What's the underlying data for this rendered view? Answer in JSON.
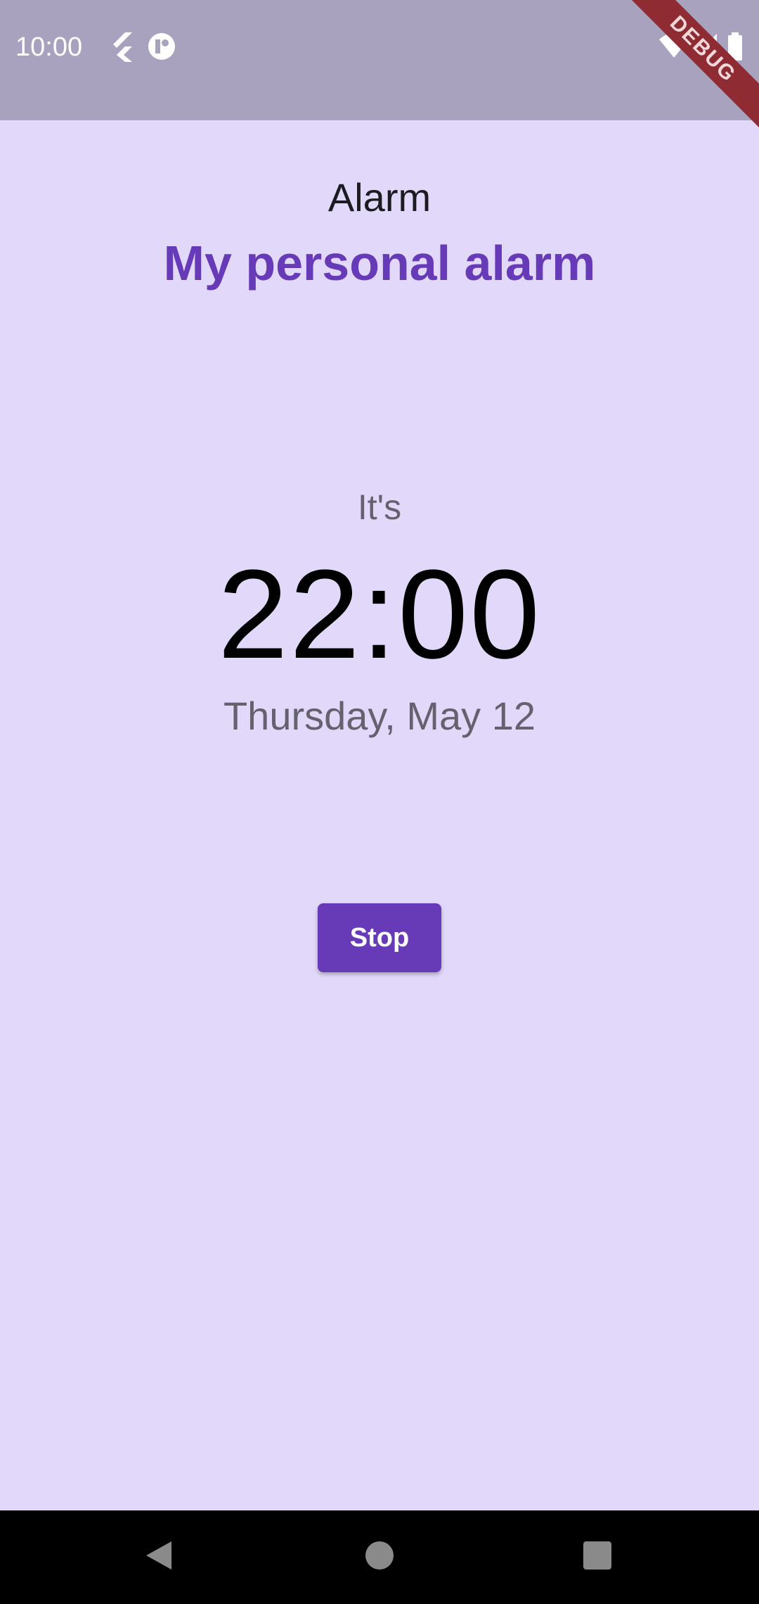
{
  "status_bar": {
    "time": "10:00",
    "left_icons": [
      "flutter-icon",
      "app-notification-icon"
    ],
    "right_icons": [
      "wifi-icon",
      "cell-signal-icon",
      "battery-icon"
    ],
    "debug_banner": "DEBUG",
    "background": "#A9A2BE"
  },
  "header": {
    "title": "Alarm",
    "subtitle": "My personal alarm",
    "subtitle_color": "#673AB7"
  },
  "clock": {
    "prefix": "It's",
    "time": "22:00",
    "date": "Thursday, May 12"
  },
  "actions": {
    "stop_label": "Stop",
    "accent_color": "#673AB7"
  },
  "nav_bar": {
    "buttons": [
      "back-icon",
      "home-icon",
      "recents-icon"
    ]
  },
  "theme": {
    "background": "#E2D9FA",
    "muted_text": "#65616E"
  }
}
